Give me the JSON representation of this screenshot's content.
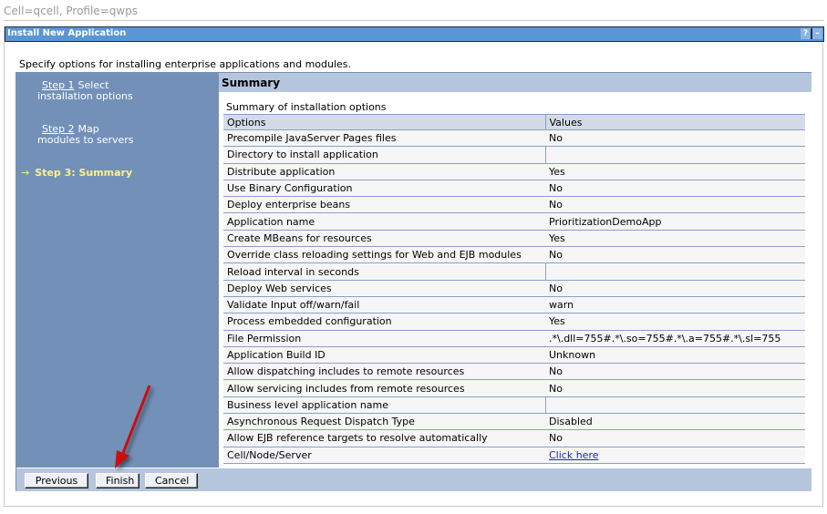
{
  "context": "Cell=qcell, Profile=qwps",
  "portlet": {
    "title": "Install New Application",
    "help_icon": "?",
    "minimize_icon": "–"
  },
  "intro": "Specify options for installing enterprise applications and modules.",
  "steps": [
    {
      "link": "Step 1",
      "label": "Select installation options"
    },
    {
      "link": "Step 2",
      "label": "Map modules to servers"
    },
    {
      "arrow": "→",
      "label": "Step 3: Summary",
      "current": true
    }
  ],
  "summary": {
    "heading": "Summary",
    "caption": "Summary of installation options",
    "columns": [
      "Options",
      "Values"
    ],
    "rows": [
      {
        "option": "Precompile JavaServer Pages files",
        "value": "No"
      },
      {
        "option": "Directory to install application",
        "value": ""
      },
      {
        "option": "Distribute application",
        "value": "Yes"
      },
      {
        "option": "Use Binary Configuration",
        "value": "No"
      },
      {
        "option": "Deploy enterprise beans",
        "value": "No"
      },
      {
        "option": "Application name",
        "value": "PrioritizationDemoApp"
      },
      {
        "option": "Create MBeans for resources",
        "value": "Yes"
      },
      {
        "option": "Override class reloading settings for Web and EJB modules",
        "value": "No"
      },
      {
        "option": "Reload interval in seconds",
        "value": ""
      },
      {
        "option": "Deploy Web services",
        "value": "No"
      },
      {
        "option": "Validate Input off/warn/fail",
        "value": "warn"
      },
      {
        "option": "Process embedded configuration",
        "value": "Yes"
      },
      {
        "option": "File Permission",
        "value": ".*\\.dll=755#.*\\.so=755#.*\\.a=755#.*\\.sl=755"
      },
      {
        "option": "Application Build ID",
        "value": "Unknown"
      },
      {
        "option": "Allow dispatching includes to remote resources",
        "value": "No"
      },
      {
        "option": "Allow servicing includes from remote resources",
        "value": "No"
      },
      {
        "option": "Business level application name",
        "value": ""
      },
      {
        "option": "Asynchronous Request Dispatch Type",
        "value": "Disabled"
      },
      {
        "option": "Allow EJB reference targets to resolve automatically",
        "value": "No"
      },
      {
        "option": "Cell/Node/Server",
        "value": "Click here",
        "link": true
      }
    ]
  },
  "buttons": {
    "previous": "Previous",
    "finish": "Finish",
    "cancel": "Cancel"
  },
  "annotation": {
    "arrow_color": "#cc1111",
    "points_to": "finish-button"
  }
}
